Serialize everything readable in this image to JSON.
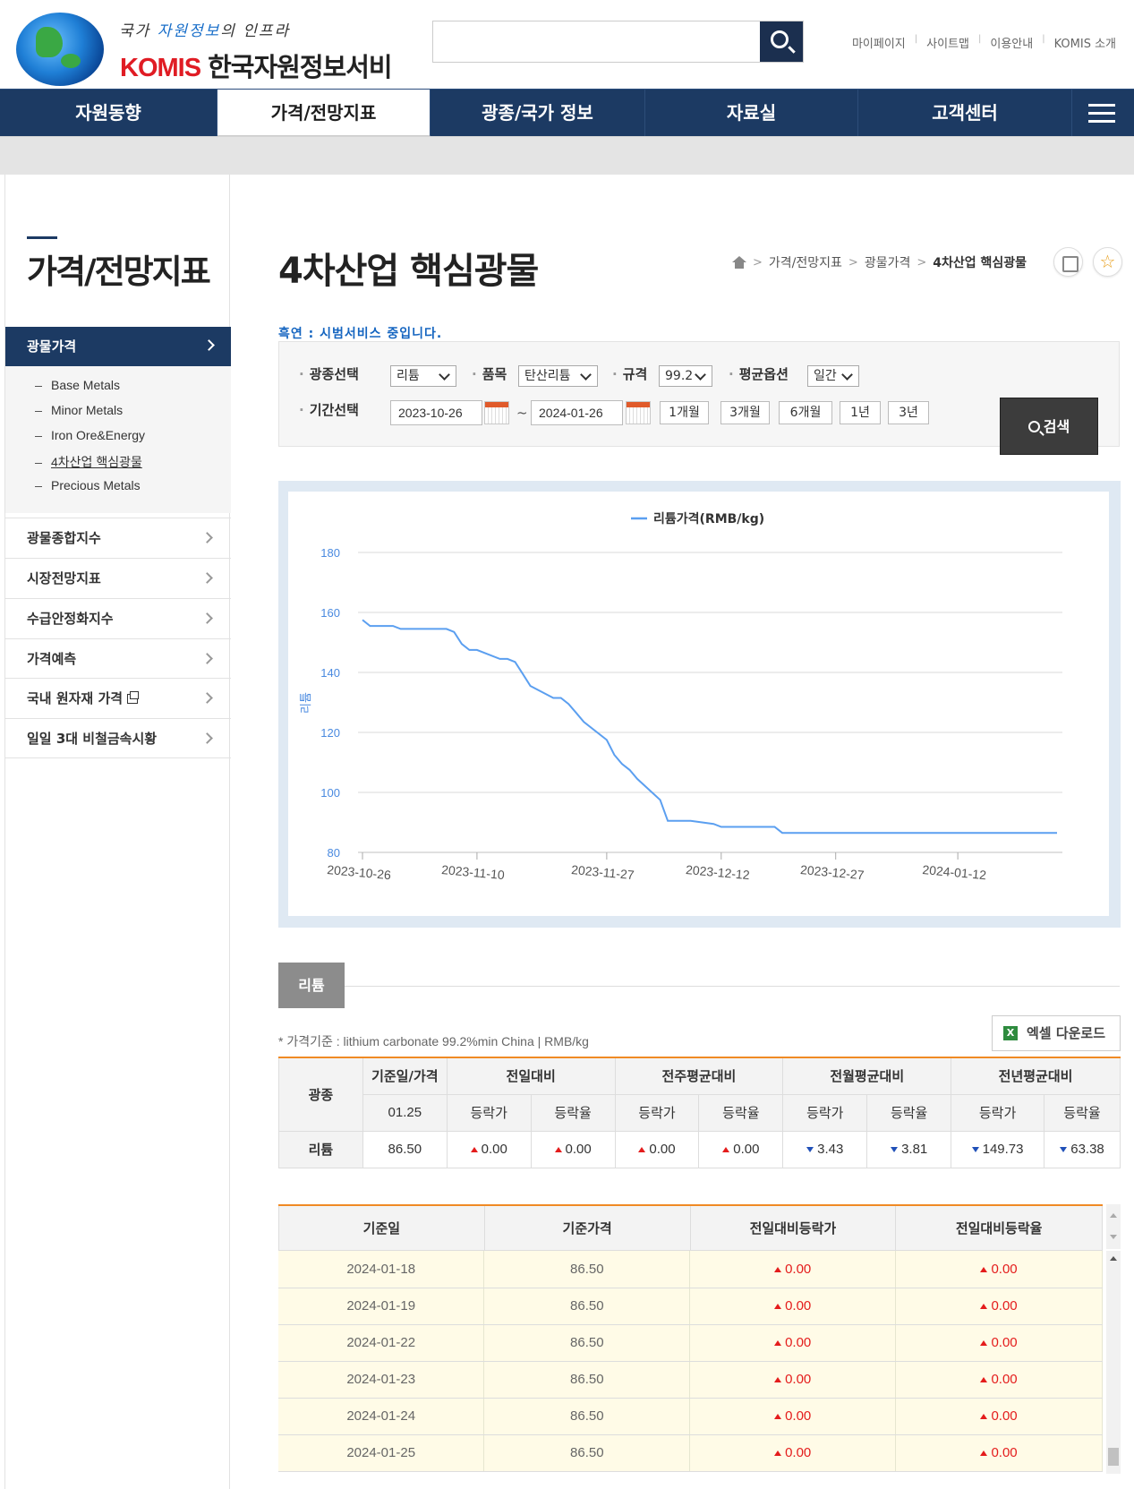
{
  "header": {
    "slogan_a": "국가",
    "slogan_b": "자원정보",
    "slogan_c": "의 인프라",
    "brand_en": "KOMIS",
    "brand_ko": "한국자원정보서비스",
    "search_placeholder": "",
    "util_links": [
      "마이페이지",
      "사이트맵",
      "이용안내",
      "KOMIS 소개"
    ]
  },
  "gnb": {
    "items": [
      "자원동향",
      "가격/전망지표",
      "광종/국가 정보",
      "자료실",
      "고객센터"
    ],
    "active": "가격/전망지표"
  },
  "lnb": {
    "title": "가격/전망지표",
    "active_item": "광물가격",
    "sub_items": [
      "Base Metals",
      "Minor Metals",
      "Iron Ore&Energy",
      "4차산업 핵심광물",
      "Precious Metals"
    ],
    "current_sub": "4차산업 핵심광물",
    "items": [
      "광물종합지수",
      "시장전망지표",
      "수급안정화지수",
      "가격예측",
      "국내 원자재 가격",
      "일일 3대 비철금속시황"
    ]
  },
  "content": {
    "page_title": "4차산업 핵심광물",
    "breadcrumb": [
      "가격/전망지표",
      "광물가격",
      "4차산업 핵심광물"
    ],
    "notice": "흑연 : 시범서비스 중입니다."
  },
  "filter": {
    "mineral_label": "광종선택",
    "mineral_value": "리튬",
    "item_label": "품목",
    "item_value": "탄산리튬",
    "spec_label": "규격",
    "spec_value": "99.2",
    "avg_label": "평균옵션",
    "avg_value": "일간",
    "period_label": "기간선택",
    "date_from": "2023-10-26",
    "date_sep": "~",
    "date_to": "2024-01-26",
    "period_buttons": [
      "1개월",
      "3개월",
      "6개월",
      "1년",
      "3년"
    ],
    "search_label": "검색"
  },
  "chart_data": {
    "type": "line",
    "title": "",
    "legend": "리튬가격(RMB/kg)",
    "legend_position": "top-center",
    "ylabel": "리튬",
    "xlabel": "",
    "ylim": [
      80,
      180
    ],
    "yticks": [
      80,
      100,
      120,
      140,
      160,
      180
    ],
    "xticks": [
      "2023-10-26",
      "2023-11-10",
      "2023-11-27",
      "2023-12-12",
      "2023-12-27",
      "2024-01-12"
    ],
    "grid": true,
    "color": "#5b9ff0",
    "series": [
      {
        "name": "리튬가격(RMB/kg)",
        "points": [
          [
            "2023-10-26",
            157.5
          ],
          [
            "2023-10-27",
            155.5
          ],
          [
            "2023-10-30",
            155.5
          ],
          [
            "2023-10-31",
            154.5
          ],
          [
            "2023-11-01",
            154.5
          ],
          [
            "2023-11-02",
            154.5
          ],
          [
            "2023-11-03",
            154.5
          ],
          [
            "2023-11-06",
            154.5
          ],
          [
            "2023-11-07",
            153.5
          ],
          [
            "2023-11-08",
            149.5
          ],
          [
            "2023-11-09",
            147.5
          ],
          [
            "2023-11-10",
            147.5
          ],
          [
            "2023-11-13",
            144.5
          ],
          [
            "2023-11-14",
            144.5
          ],
          [
            "2023-11-15",
            143.5
          ],
          [
            "2023-11-16",
            139.5
          ],
          [
            "2023-11-17",
            135.5
          ],
          [
            "2023-11-20",
            131.5
          ],
          [
            "2023-11-21",
            131.5
          ],
          [
            "2023-11-22",
            129.5
          ],
          [
            "2023-11-23",
            126.5
          ],
          [
            "2023-11-24",
            123.5
          ],
          [
            "2023-11-27",
            117.5
          ],
          [
            "2023-11-28",
            112.5
          ],
          [
            "2023-11-29",
            109.5
          ],
          [
            "2023-11-30",
            107.5
          ],
          [
            "2023-12-01",
            104.5
          ],
          [
            "2023-12-04",
            97.5
          ],
          [
            "2023-12-05",
            90.5
          ],
          [
            "2023-12-06",
            90.5
          ],
          [
            "2023-12-07",
            90.5
          ],
          [
            "2023-12-08",
            90.5
          ],
          [
            "2023-12-11",
            89.5
          ],
          [
            "2023-12-12",
            88.5
          ],
          [
            "2023-12-13",
            88.5
          ],
          [
            "2023-12-14",
            88.5
          ],
          [
            "2023-12-15",
            88.5
          ],
          [
            "2023-12-18",
            88.5
          ],
          [
            "2023-12-19",
            88.5
          ],
          [
            "2023-12-20",
            86.5
          ],
          [
            "2023-12-21",
            86.5
          ],
          [
            "2023-12-22",
            86.5
          ],
          [
            "2023-12-25",
            86.5
          ],
          [
            "2023-12-26",
            86.5
          ],
          [
            "2023-12-27",
            86.5
          ],
          [
            "2023-12-28",
            86.5
          ],
          [
            "2023-12-29",
            86.5
          ],
          [
            "2024-01-02",
            86.5
          ],
          [
            "2024-01-03",
            86.5
          ],
          [
            "2024-01-04",
            86.5
          ],
          [
            "2024-01-05",
            86.5
          ],
          [
            "2024-01-08",
            86.5
          ],
          [
            "2024-01-09",
            86.5
          ],
          [
            "2024-01-10",
            86.5
          ],
          [
            "2024-01-11",
            86.5
          ],
          [
            "2024-01-12",
            86.5
          ],
          [
            "2024-01-15",
            86.5
          ],
          [
            "2024-01-16",
            86.5
          ],
          [
            "2024-01-17",
            86.5
          ],
          [
            "2024-01-18",
            86.5
          ],
          [
            "2024-01-19",
            86.5
          ],
          [
            "2024-01-22",
            86.5
          ],
          [
            "2024-01-23",
            86.5
          ],
          [
            "2024-01-24",
            86.5
          ],
          [
            "2024-01-25",
            86.5
          ]
        ]
      }
    ]
  },
  "tab": {
    "label": "리튬"
  },
  "summary": {
    "basis": "* 가격기준 : lithium carbonate 99.2%min China  |  RMB/kg",
    "excel_label": "엑셀 다운로드",
    "h_mineral": "광종",
    "h_base": "기준일/가격",
    "h_day": "전일대비",
    "h_week": "전주평균대비",
    "h_month": "전월평균대비",
    "h_year": "전년평균대비",
    "h_price": "등락가",
    "h_rate": "등락율",
    "base_date": "01.25",
    "row": {
      "mineral": "리튬",
      "price": "86.50",
      "day_price": "0.00",
      "day_rate": "0.00",
      "week_price": "0.00",
      "week_rate": "0.00",
      "month_price": "3.43",
      "month_rate": "3.81",
      "year_price": "149.73",
      "year_rate": "63.38"
    }
  },
  "daily": {
    "headers": [
      "기준일",
      "기준가격",
      "전일대비등락가",
      "전일대비등락율"
    ],
    "rows": [
      [
        "2024-01-18",
        "86.50",
        "0.00",
        "0.00"
      ],
      [
        "2024-01-19",
        "86.50",
        "0.00",
        "0.00"
      ],
      [
        "2024-01-22",
        "86.50",
        "0.00",
        "0.00"
      ],
      [
        "2024-01-23",
        "86.50",
        "0.00",
        "0.00"
      ],
      [
        "2024-01-24",
        "86.50",
        "0.00",
        "0.00"
      ],
      [
        "2024-01-25",
        "86.50",
        "0.00",
        "0.00"
      ]
    ]
  }
}
